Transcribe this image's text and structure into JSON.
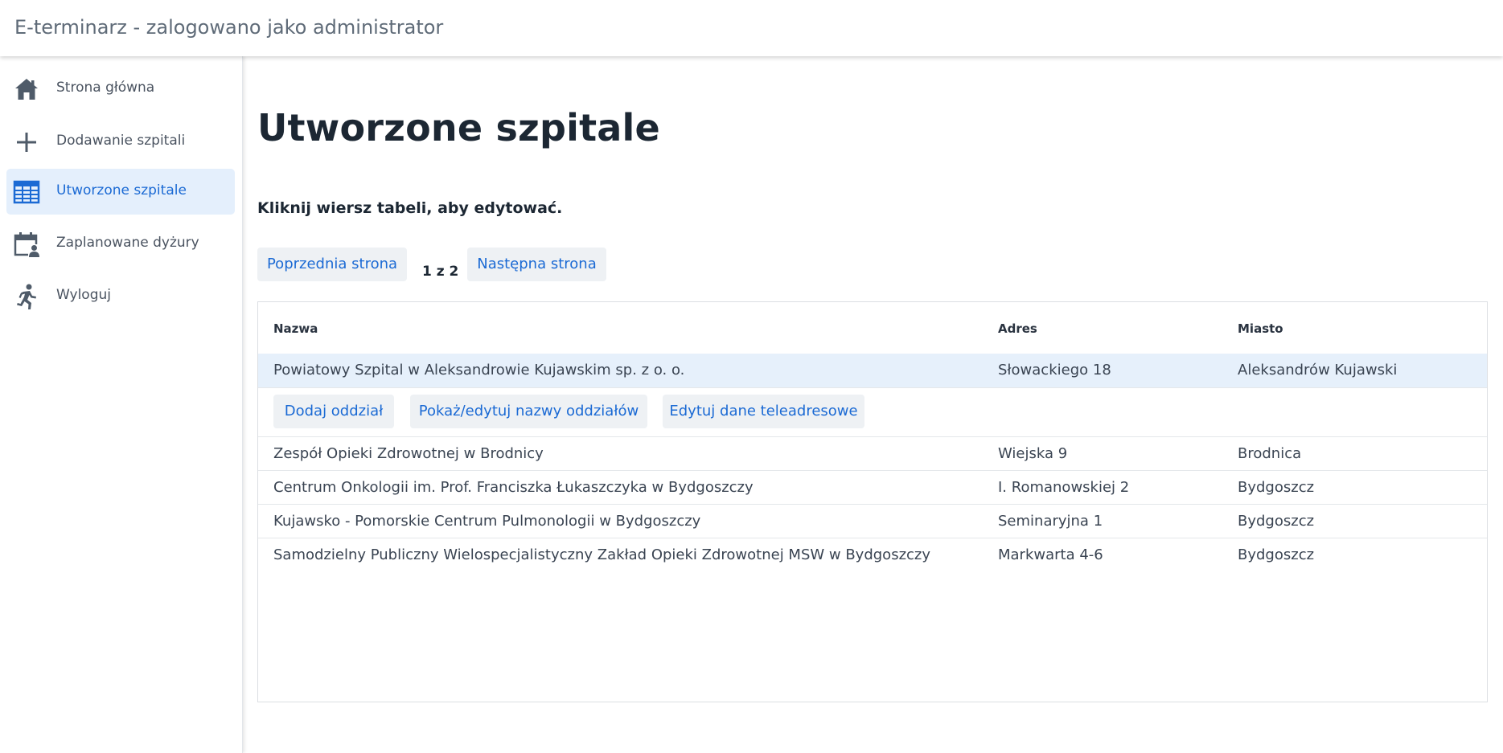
{
  "app": {
    "title": "E-terminarz - zalogowano jako administrator"
  },
  "sidebar": {
    "items": [
      {
        "label": "Strona główna",
        "icon": "home-icon",
        "active": false
      },
      {
        "label": "Dodawanie szpitali",
        "icon": "plus-icon",
        "active": false
      },
      {
        "label": "Utworzone szpitale",
        "icon": "table-icon",
        "active": true
      },
      {
        "label": "Zaplanowane dyżury",
        "icon": "calendar-user-icon",
        "active": false
      },
      {
        "label": "Wyloguj",
        "icon": "running-person-icon",
        "active": false
      }
    ]
  },
  "main": {
    "title": "Utworzone szpitale",
    "hint": "Kliknij wiersz tabeli, aby edytować.",
    "pager": {
      "prev_label": "Poprzednia strona",
      "info": "1 z 2",
      "next_label": "Następna strona"
    },
    "table": {
      "columns": [
        "Nazwa",
        "Adres",
        "Miasto"
      ],
      "rows": [
        {
          "name": "Powiatowy Szpital w Aleksandrowie Kujawskim sp. z o. o.",
          "address": "Słowackiego 18",
          "city": "Aleksandrów Kujawski",
          "selected": true
        },
        {
          "name": "Zespół Opieki Zdrowotnej w Brodnicy",
          "address": "Wiejska 9",
          "city": "Brodnica",
          "selected": false
        },
        {
          "name": "Centrum Onkologii im. Prof. Franciszka Łukaszczyka w Bydgoszczy",
          "address": "I. Romanowskiej 2",
          "city": "Bydgoszcz",
          "selected": false
        },
        {
          "name": "Kujawsko - Pomorskie Centrum Pulmonologii w Bydgoszczy",
          "address": "Seminaryjna 1",
          "city": "Bydgoszcz",
          "selected": false
        },
        {
          "name": "Samodzielny Publiczny Wielospecjalistyczny Zakład Opieki Zdrowotnej MSW w Bydgoszczy",
          "address": "Markwarta 4-6",
          "city": "Bydgoszcz",
          "selected": false
        }
      ],
      "row_actions": {
        "add_department": "Dodaj oddział",
        "show_edit_departments": "Pokaż/edytuj nazwy oddziałów",
        "edit_contact": "Edytuj dane teleadresowe"
      }
    }
  },
  "colors": {
    "accent": "#1b6ad4",
    "active_bg": "#e4effc",
    "selected_row_bg": "#e6f0fb",
    "button_bg": "#eef1f4",
    "icon": "#4f5b69"
  }
}
